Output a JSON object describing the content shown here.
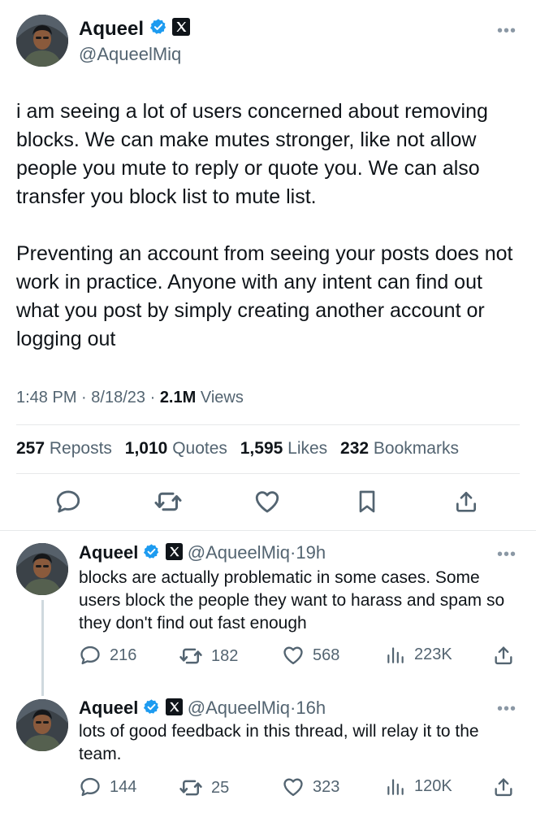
{
  "main_tweet": {
    "author_name": "Aqueel",
    "handle": "@AqueelMiq",
    "paragraphs": [
      "i am seeing a lot of users concerned about removing blocks. We can make mutes stronger, like not allow people you mute to reply or quote you. We can also transfer you block list to mute list.",
      "Preventing an account from seeing your posts does not work in practice. Anyone with any intent can find out what you post by simply creating another account or logging out"
    ],
    "time": "1:48 PM",
    "date": "8/18/23",
    "views_count": "2.1M",
    "views_label": "Views",
    "stats": {
      "reposts_count": "257",
      "reposts_label": "Reposts",
      "quotes_count": "1,010",
      "quotes_label": "Quotes",
      "likes_count": "1,595",
      "likes_label": "Likes",
      "bookmarks_count": "232",
      "bookmarks_label": "Bookmarks"
    },
    "actions": [
      "reply-icon",
      "repost-icon",
      "like-icon",
      "bookmark-icon",
      "share-icon"
    ]
  },
  "replies": [
    {
      "author_name": "Aqueel",
      "handle": "@AqueelMiq",
      "time": "19h",
      "text": "blocks are actually problematic in some cases. Some users block the people they want to harass and spam so they don't find out fast enough",
      "replies": "216",
      "reposts": "182",
      "likes": "568",
      "views": "223K"
    },
    {
      "author_name": "Aqueel",
      "handle": "@AqueelMiq",
      "time": "16h",
      "text": "lots of good feedback in this thread, will relay it to the team.",
      "replies": "144",
      "reposts": "25",
      "likes": "323",
      "views": "120K"
    }
  ],
  "separator": "·",
  "more_glyph": "•••",
  "colors": {
    "verified": "#1d9bf0",
    "text": "#0f1419",
    "secondary": "#536471",
    "divider": "#e7e9ea"
  }
}
